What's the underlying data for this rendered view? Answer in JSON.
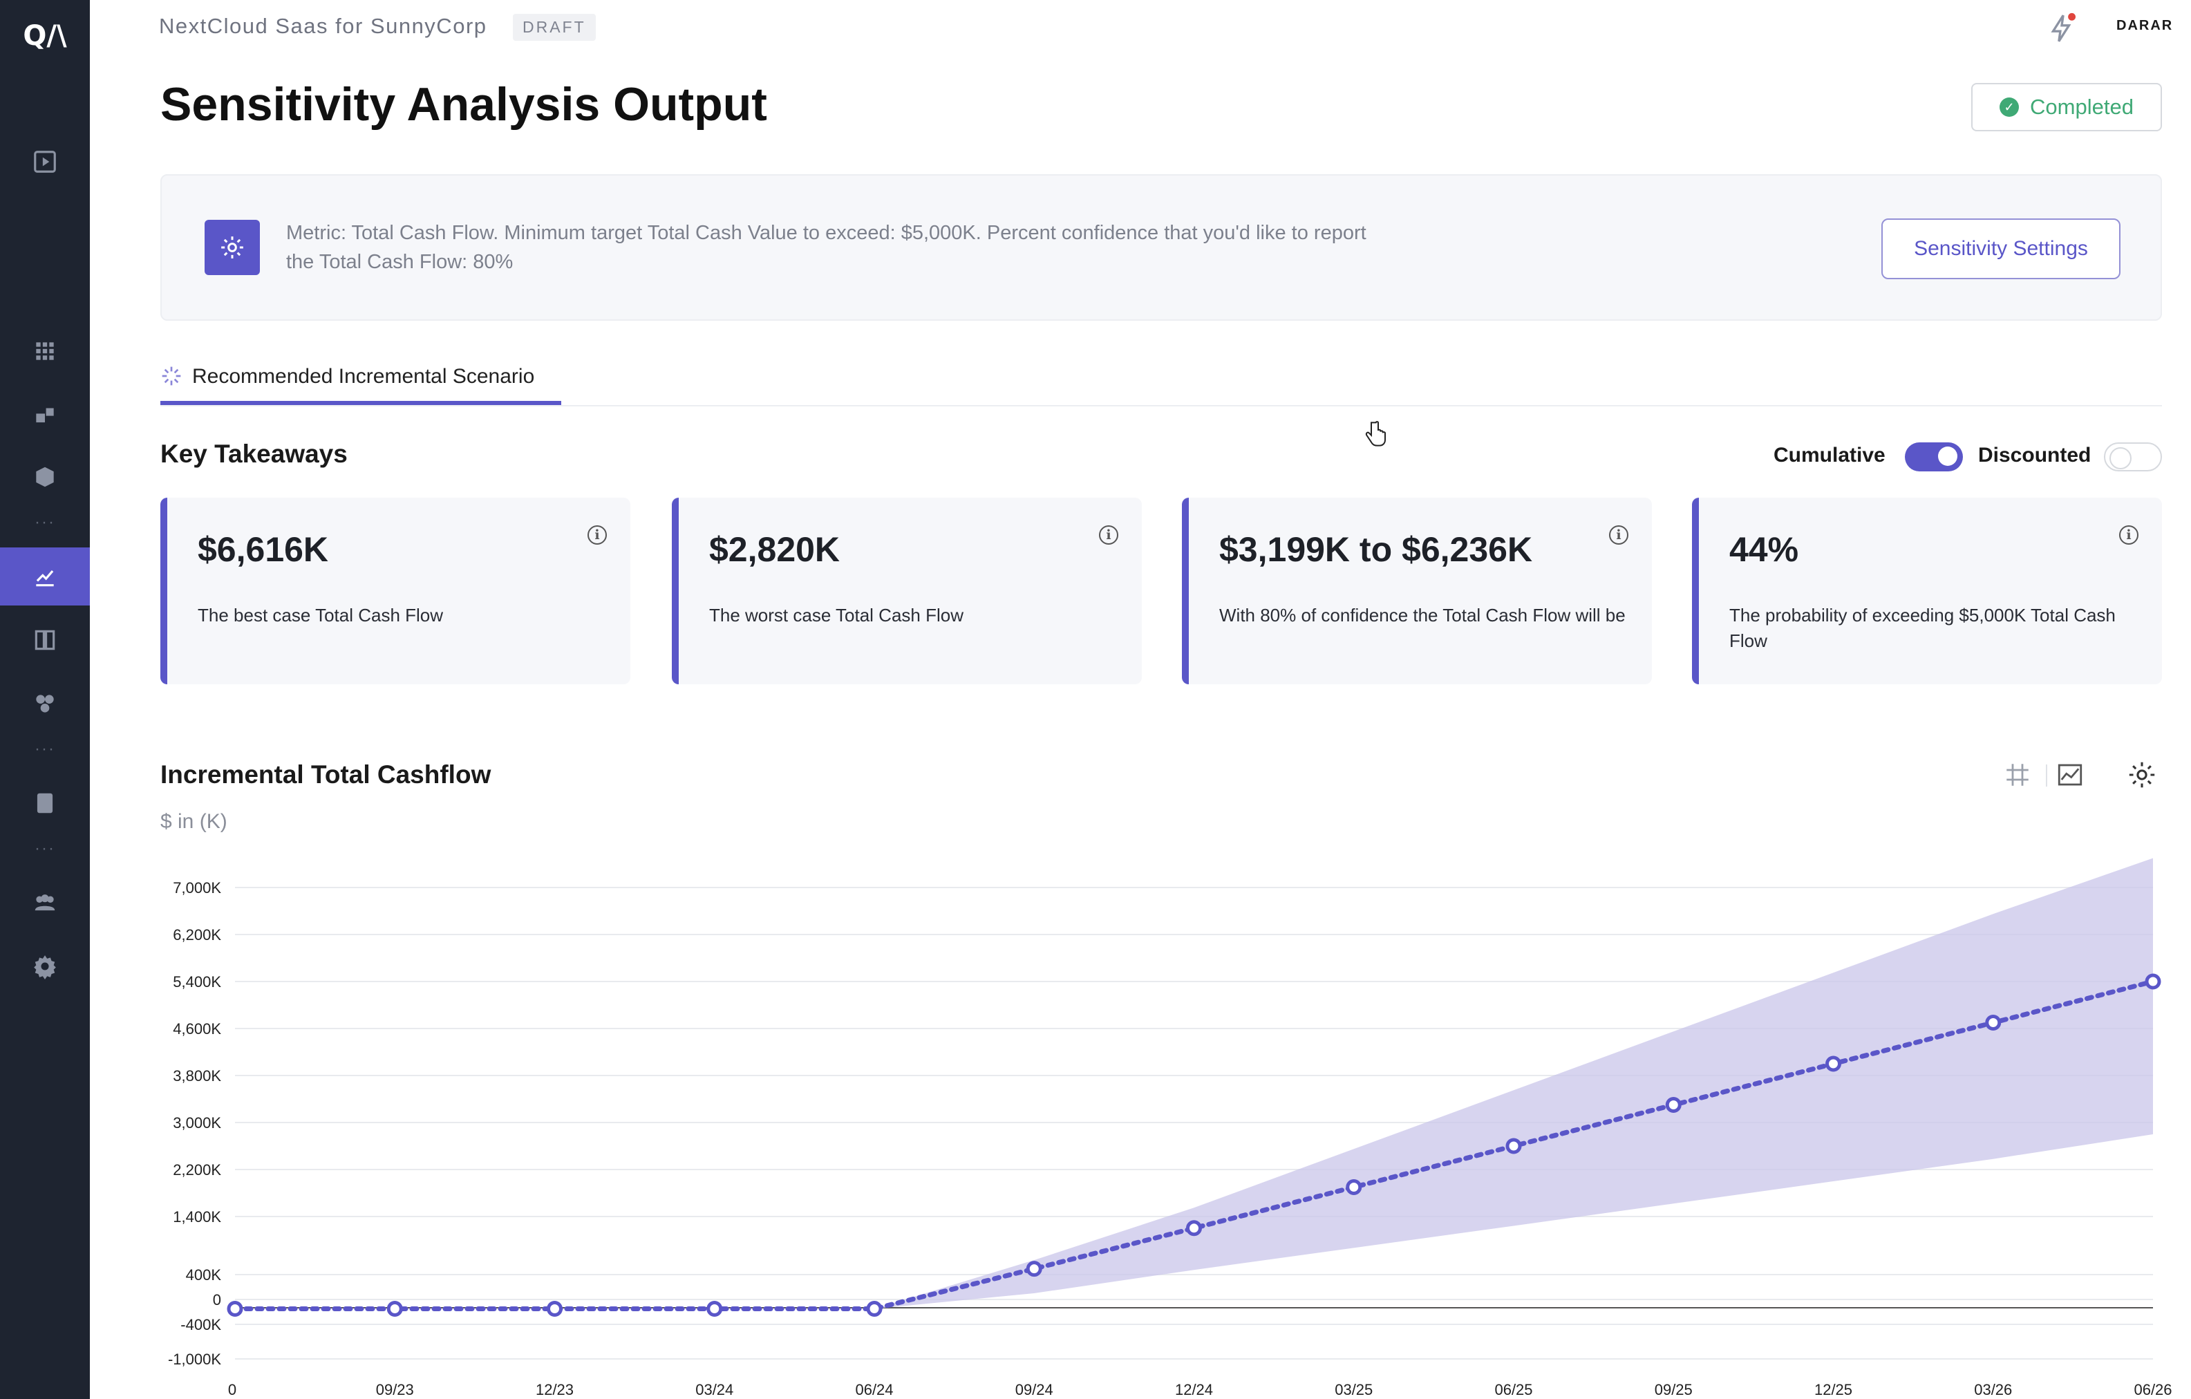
{
  "header": {
    "project_title": "NextCloud Saas for SunnyCorp",
    "draft_badge": "DRAFT",
    "user_initials": "DARAR",
    "status": "Completed"
  },
  "page": {
    "title": "Sensitivity Analysis Output"
  },
  "info_panel": {
    "text": "Metric: Total Cash Flow. Minimum target Total Cash Value to exceed: $5,000K. Percent confidence that you'd like to report the Total Cash Flow: 80%",
    "button": "Sensitivity Settings"
  },
  "tabs": [
    {
      "label": "Recommended Incremental Scenario",
      "active": true
    }
  ],
  "takeaways": {
    "title": "Key Takeaways",
    "toggles": [
      {
        "label": "Cumulative",
        "on": true
      },
      {
        "label": "Discounted",
        "on": false
      }
    ],
    "cards": [
      {
        "value": "$6,616K",
        "description": "The best case Total Cash Flow"
      },
      {
        "value": "$2,820K",
        "description": "The worst case Total Cash Flow"
      },
      {
        "value": "$3,199K to $6,236K",
        "description": "With 80% of confidence the Total Cash Flow will be"
      },
      {
        "value": "44%",
        "description": "The probability of exceeding $5,000K Total Cash Flow"
      }
    ]
  },
  "chart_section": {
    "title": "Incremental Total Cashflow",
    "subtitle": "$ in (K)"
  },
  "icons": {
    "sidebar": [
      "play-icon",
      "grid-icon",
      "blocks-icon",
      "cube-icon",
      "chart-edit-icon",
      "compare-icon",
      "molecule-icon",
      "calculator-icon",
      "team-icon",
      "gear-icon"
    ],
    "toolbar": [
      "lightning-icon",
      "table-grid-icon",
      "line-chart-icon",
      "settings-gear-icon"
    ]
  },
  "colors": {
    "accent": "#5a56c8",
    "band": "#c9c5ea",
    "status_green": "#3fa975",
    "sidebar": "#1e2430"
  },
  "chart_data": {
    "type": "line",
    "title": "Incremental Total Cashflow",
    "ylabel": "$ in (K)",
    "x": [
      "0",
      "09/23",
      "12/23",
      "03/24",
      "06/24",
      "09/24",
      "12/24",
      "03/25",
      "06/25",
      "09/25",
      "12/25",
      "03/26",
      "06/26"
    ],
    "y_ticks": [
      "7,000K",
      "6,200K",
      "5,400K",
      "4,600K",
      "3,800K",
      "3,000K",
      "2,200K",
      "1,400K",
      "400K",
      "0",
      "-400K",
      "-1,000K"
    ],
    "series": [
      {
        "values": [
          -150,
          -150,
          -150,
          -150,
          -150,
          500,
          1200,
          1900,
          2600,
          3300,
          4000,
          4700,
          5400
        ]
      }
    ],
    "band": {
      "lower": [
        null,
        null,
        null,
        null,
        -150,
        100,
        480,
        860,
        1240,
        1620,
        2000,
        2380,
        2800
      ],
      "upper": [
        null,
        null,
        null,
        null,
        -150,
        650,
        1550,
        2550,
        3550,
        4550,
        5550,
        6550,
        7500
      ]
    },
    "grid": true
  }
}
